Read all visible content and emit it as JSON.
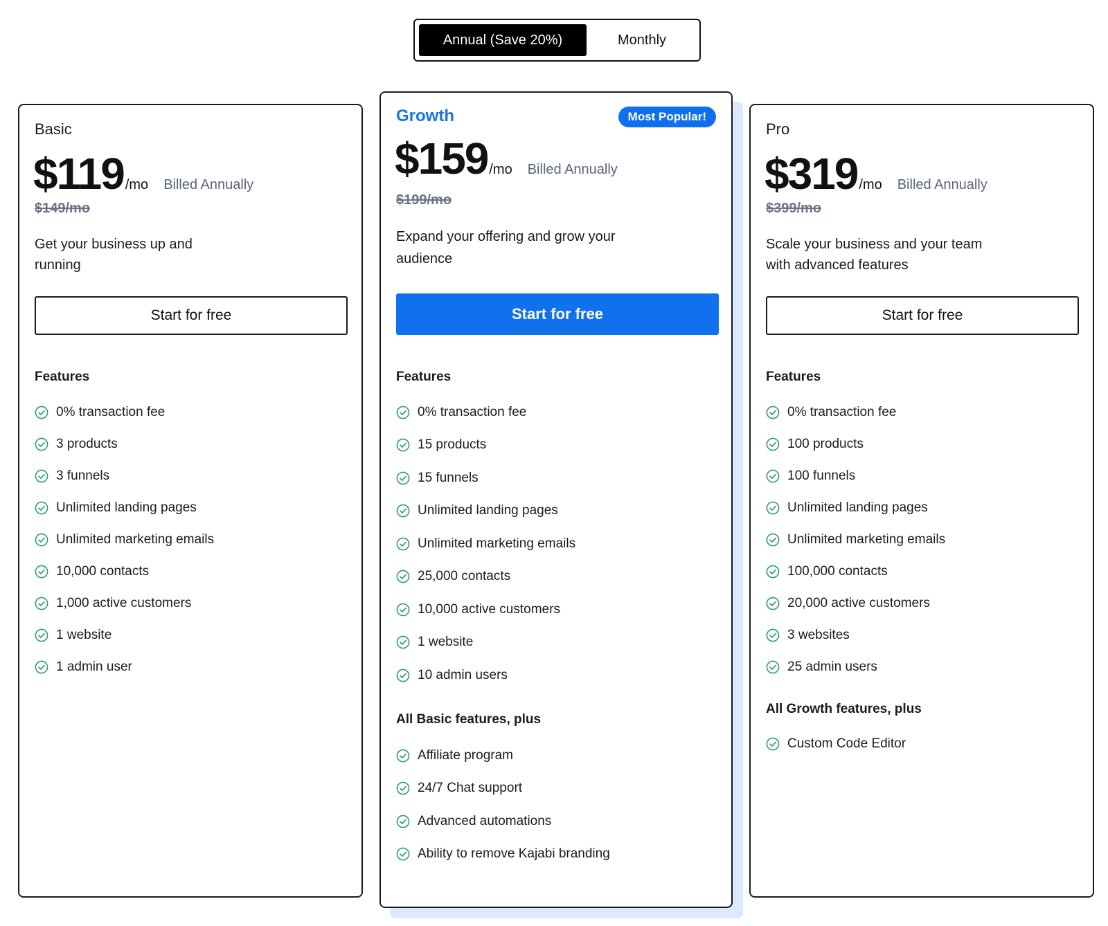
{
  "billing_toggle": {
    "annual_label": "Annual (Save 20%)",
    "monthly_label": "Monthly",
    "selected": "annual"
  },
  "colors": {
    "accent_blue": "#0f71ed",
    "check_green": "#2e9e6b",
    "shadow_blue": "#dce9fb"
  },
  "plans": [
    {
      "name": "Basic",
      "price": "$119",
      "per": "/mo",
      "billed": "Billed Annually",
      "old_price": "$149/mo",
      "description": "Get your business up and running",
      "cta": "Start for free",
      "features_title": "Features",
      "features": [
        "0% transaction fee",
        "3 products",
        "3 funnels",
        "Unlimited landing pages",
        "Unlimited marketing emails",
        "10,000 contacts",
        "1,000 active customers",
        "1 website",
        "1 admin user"
      ]
    },
    {
      "name": "Growth",
      "badge": "Most Popular!",
      "price": "$159",
      "per": "/mo",
      "billed": "Billed Annually",
      "old_price": "$199/mo",
      "description": "Expand your offering and grow your audience",
      "cta": "Start for free",
      "features_title": "Features",
      "features": [
        "0% transaction fee",
        "15 products",
        "15 funnels",
        "Unlimited landing pages",
        "Unlimited marketing emails",
        "25,000 contacts",
        "10,000 active customers",
        "1 website",
        "10 admin users"
      ],
      "extra_title": "All Basic features, plus",
      "extra_features": [
        "Affiliate program",
        "24/7 Chat support",
        "Advanced automations",
        "Ability to remove Kajabi branding"
      ]
    },
    {
      "name": "Pro",
      "price": "$319",
      "per": "/mo",
      "billed": "Billed Annually",
      "old_price": "$399/mo",
      "description": "Scale your business and your team with advanced features",
      "cta": "Start for free",
      "features_title": "Features",
      "features": [
        "0% transaction fee",
        "100 products",
        "100 funnels",
        "Unlimited landing pages",
        "Unlimited marketing emails",
        "100,000 contacts",
        "20,000 active customers",
        "3 websites",
        "25 admin users"
      ],
      "extra_title": "All Growth features, plus",
      "extra_features": [
        "Custom Code Editor"
      ]
    }
  ]
}
